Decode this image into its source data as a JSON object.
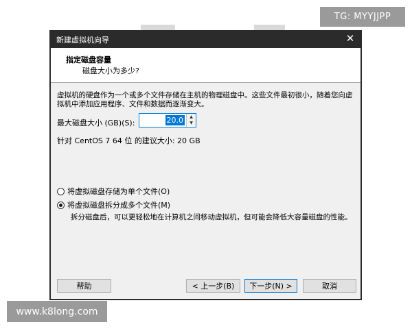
{
  "watermarks": {
    "top_right": "TG: MYYJJPP",
    "bottom_left": "www.k8long.com"
  },
  "dialog": {
    "title": "新建虚拟机向导",
    "close_glyph": "✕",
    "header_title": "指定磁盘容量",
    "header_subtitle": "磁盘大小为多少?",
    "description": "虚拟机的硬盘作为一个或多个文件存储在主机的物理磁盘中。这些文件最初很小，随着您向虚拟机中添加应用程序、文件和数据而逐渐变大。",
    "max_size_label": "最大磁盘大小 (GB)(S):",
    "max_size_value": "20.0",
    "recommended": "针对 CentOS 7 64 位 的建议大小: 20 GB",
    "options": [
      {
        "label": "将虚拟磁盘存储为单个文件(O)",
        "checked": false
      },
      {
        "label": "将虚拟磁盘拆分成多个文件(M)",
        "checked": true
      }
    ],
    "split_note": "拆分磁盘后，可以更轻松地在计算机之间移动虚拟机，但可能会降低大容量磁盘的性能。",
    "buttons": {
      "help": "帮助",
      "back": "< 上一步(B)",
      "next": "下一步(N) >",
      "cancel": "取消"
    }
  },
  "colors": {
    "accent": "#0078d7",
    "titlebar": "#2b2b2b",
    "client_bg": "#f0f0f0"
  }
}
